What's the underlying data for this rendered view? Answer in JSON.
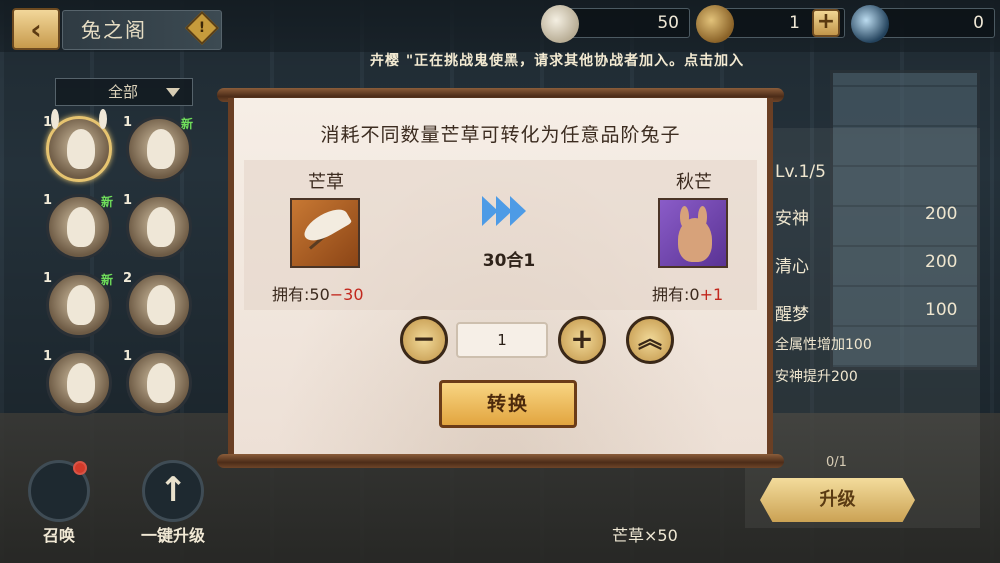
{
  "topbar": {
    "back_icon": "back-arrow-icon",
    "title": "兔之阁",
    "warn_icon": "exclamation-icon",
    "resources": [
      {
        "icon": "silvergrass-icon",
        "value": "50"
      },
      {
        "icon": "bell-icon",
        "value": "1"
      },
      {
        "icon": "moon-icon",
        "value": "0"
      }
    ],
    "plus_label": "+",
    "ticker": "卉樱 \"正在挑战鬼使黑，请求其他协战者加入。点击加入"
  },
  "sidebar": {
    "filter_label": "全部",
    "slots": [
      {
        "level": "1",
        "new": "",
        "selected": true
      },
      {
        "level": "1",
        "new": "新",
        "selected": false
      },
      {
        "level": "1",
        "new": "新",
        "selected": false
      },
      {
        "level": "1",
        "new": "",
        "selected": false
      },
      {
        "level": "1",
        "new": "新",
        "selected": false
      },
      {
        "level": "2",
        "new": "",
        "selected": false
      },
      {
        "level": "1",
        "new": "",
        "selected": false
      },
      {
        "level": "1",
        "new": "",
        "selected": false
      }
    ],
    "summon_label": "召唤",
    "upgrade_all_label": "一键升级"
  },
  "detail": {
    "level_text": "Lv.1/5",
    "stats": [
      {
        "name": "安神",
        "value": "200"
      },
      {
        "name": "清心",
        "value": "200"
      },
      {
        "name": "醒梦",
        "value": "100"
      }
    ],
    "effect1": "全属性增加100",
    "effect2": "安神提升200",
    "progress": "0/1",
    "upgrade_label": "升级",
    "mangcao_count": "芒草×50"
  },
  "dialog": {
    "title": "消耗不同数量芒草可转化为任意品阶兔子",
    "from_name": "芒草",
    "from_owned_prefix": "拥有:50",
    "from_owned_delta": "−30",
    "to_name": "秋芒",
    "to_owned_prefix": "拥有:0",
    "to_owned_delta": "+1",
    "ratio": "30合1",
    "quantity": "1",
    "minus_label": "−",
    "plus_label": "+",
    "max_label": "︽",
    "convert_label": "转换"
  }
}
